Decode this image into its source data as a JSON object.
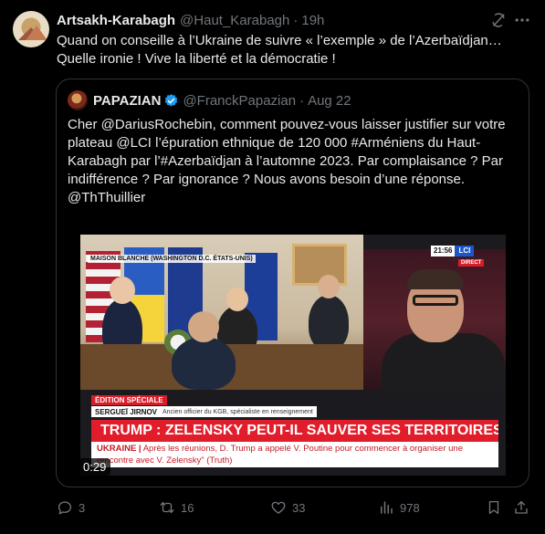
{
  "tweet": {
    "author_name": "Artsakh-Karabagh",
    "handle": "@Haut_Karabagh",
    "separator": "·",
    "time": "19h",
    "text": "Quand on conseille à l’Ukraine de suivre « l’exemple » de l’Azerbaïdjan…\nQuelle ironie ! Vive la liberté et la démocratie !"
  },
  "quote": {
    "author_name": "PAPAZIAN",
    "handle": "@FranckPapazian",
    "separator": "·",
    "date": "Aug 22",
    "text": "Cher @DariusRochebin, comment pouvez-vous laisser justifier sur votre plateau @LCI l’épuration ethnique de 120 000 #Arméniens du Haut-Karabagh par l’#Azerbaïdjan à l’automne 2023. Par complaisance ? Par indifférence ? Par ignorance ? Nous avons besoin d’une réponse. @ThThuillier",
    "video": {
      "location_label": "MAISON BLANCHE (WASHINGTON D.C. ÉTATS-UNIS)",
      "clock": "21:56",
      "channel": "LCI",
      "live": "DIRECT",
      "edition_tag": "ÉDITION SPÉCIALE",
      "guest_name": "SERGUEÏ JIRNOV",
      "guest_role": "Ancien officier du KGB, spécialiste en renseignement",
      "headline": "TRUMP : ZELENSKY PEUT-IL SAUVER SES TERRITOIRES ?",
      "ticker_prefix": "UKRAINE |",
      "ticker_text": "Après les réunions, D. Trump a appelé V. Poutine pour commencer à organiser une rencontre avec V. Zelensky\" (Truth)",
      "duration": "0:29"
    }
  },
  "actions": {
    "replies": "3",
    "reposts": "16",
    "likes": "33",
    "views": "978"
  },
  "colors": {
    "background": "#000000",
    "text": "#e7e9ea",
    "muted": "#71767b",
    "border": "#2f3336",
    "verified": "#1d9bf0",
    "lci_red": "#e21d2b"
  },
  "icons": [
    "grok-icon",
    "more-icon",
    "verified-icon",
    "reply-icon",
    "repost-icon",
    "like-icon",
    "views-icon",
    "bookmark-icon",
    "share-icon"
  ]
}
